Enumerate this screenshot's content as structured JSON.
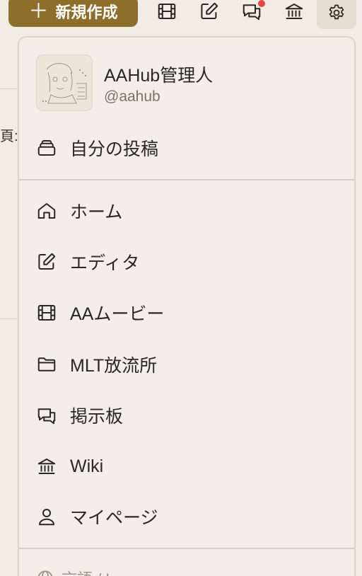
{
  "topbar": {
    "new_post_label": "新規作成",
    "icons": [
      "film-icon",
      "edit-icon",
      "chat-icon",
      "bank-icon",
      "gear-icon"
    ]
  },
  "background": {
    "fragment": "頁:"
  },
  "profile": {
    "name": "AAHub管理人",
    "handle": "@aahub"
  },
  "menu": {
    "my_posts": "自分の投稿",
    "items": [
      {
        "label": "ホーム",
        "icon": "home-icon"
      },
      {
        "label": "エディタ",
        "icon": "edit-icon"
      },
      {
        "label": "AAムービー",
        "icon": "film-icon"
      },
      {
        "label": "MLT放流所",
        "icon": "folder-icon"
      },
      {
        "label": "掲示板",
        "icon": "chat-icon"
      },
      {
        "label": "Wiki",
        "icon": "bank-icon"
      },
      {
        "label": "マイページ",
        "icon": "user-icon"
      }
    ],
    "language_label": "言語 / Language"
  },
  "colors": {
    "accent": "#8d6f2b",
    "notification": "#e8453c",
    "panel": "#f3efe8",
    "page": "#f1ece4"
  }
}
